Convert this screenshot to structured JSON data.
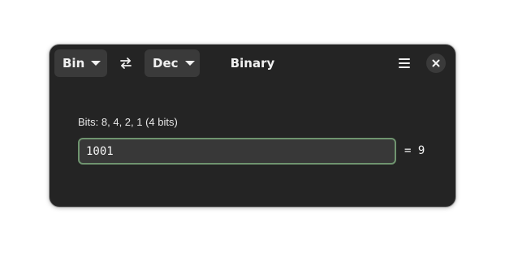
{
  "window": {
    "title": "Binary"
  },
  "header": {
    "from_unit": "Bin",
    "to_unit": "Dec",
    "swap_icon": "swap-arrows-icon",
    "menu_icon": "hamburger-menu-icon",
    "close_icon": "close-icon"
  },
  "main": {
    "bits_info": "Bits: 8, 4, 2, 1 (4 bits)",
    "input_value": "1001",
    "result": "= 9"
  },
  "colors": {
    "window_bg": "#242424",
    "button_bg": "#3a3a3a",
    "input_bg": "#383838",
    "input_border": "#6f946f",
    "text": "#f0f0f0"
  }
}
